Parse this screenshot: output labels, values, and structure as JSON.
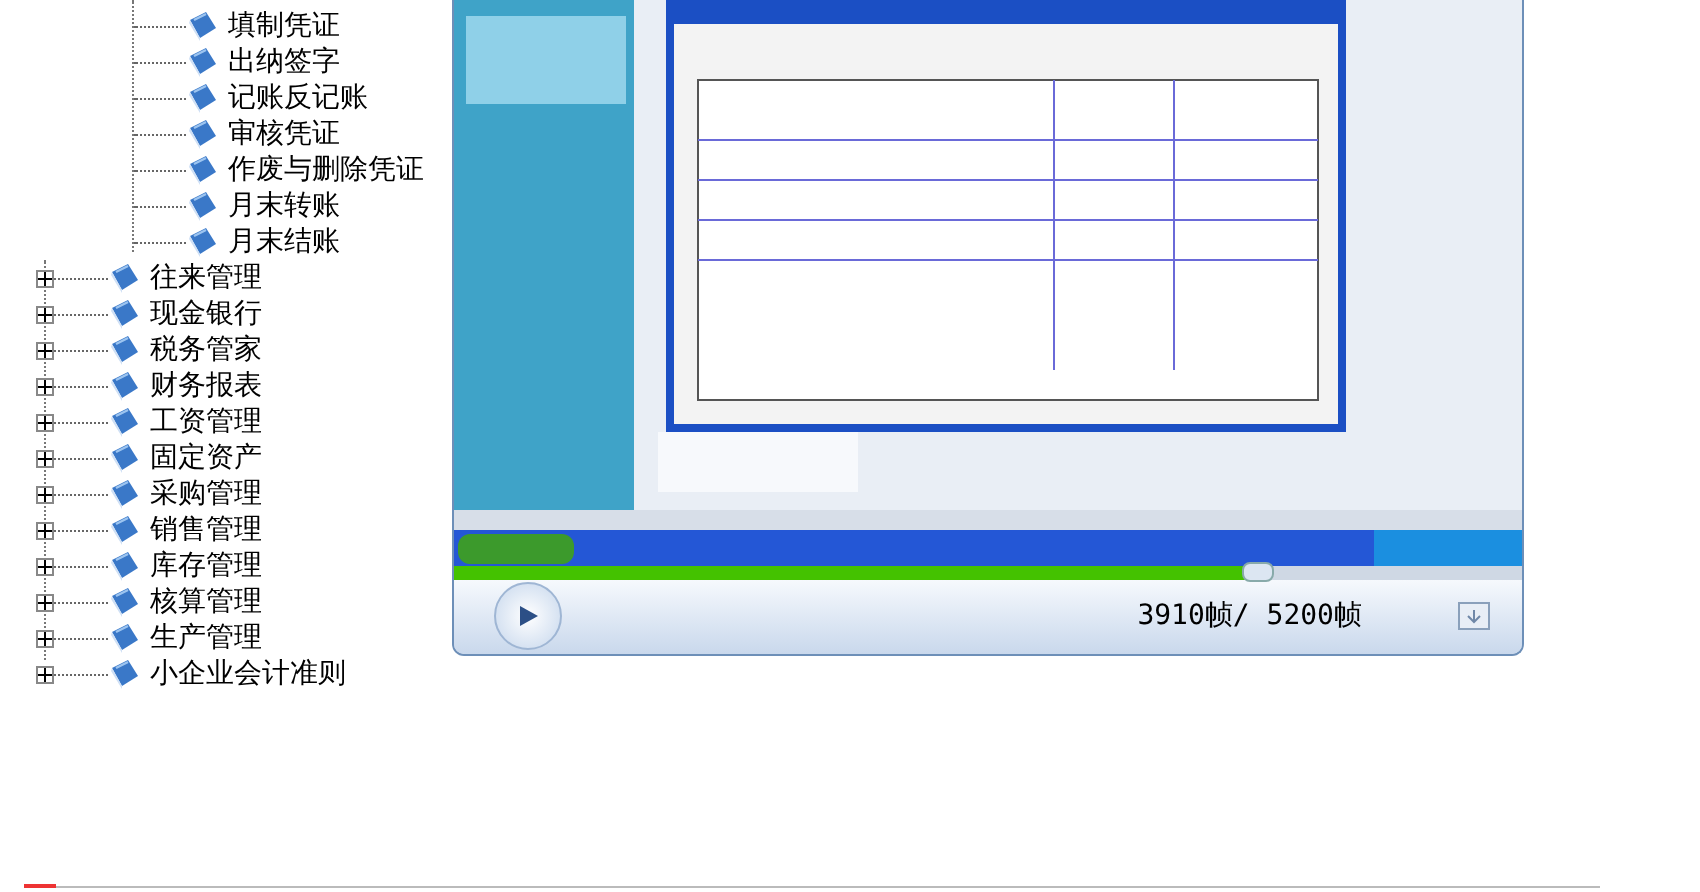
{
  "tree": {
    "children": [
      {
        "label": "填制凭证"
      },
      {
        "label": "出纳签字"
      },
      {
        "label": "记账反记账"
      },
      {
        "label": "审核凭证"
      },
      {
        "label": "作废与删除凭证"
      },
      {
        "label": "月末转账"
      },
      {
        "label": "月末结账"
      }
    ],
    "modules": [
      {
        "label": "往来管理",
        "expanded": false
      },
      {
        "label": "现金银行",
        "expanded": false
      },
      {
        "label": "税务管家",
        "expanded": false
      },
      {
        "label": "财务报表",
        "expanded": false
      },
      {
        "label": "工资管理",
        "expanded": false
      },
      {
        "label": "固定资产",
        "expanded": false
      },
      {
        "label": "采购管理",
        "expanded": false
      },
      {
        "label": "销售管理",
        "expanded": false
      },
      {
        "label": "库存管理",
        "expanded": false
      },
      {
        "label": "核算管理",
        "expanded": false
      },
      {
        "label": "生产管理",
        "expanded": false
      },
      {
        "label": "小企业会计准则",
        "expanded": false
      }
    ]
  },
  "player": {
    "progress": {
      "level": 0.752
    },
    "frame_counter": "3910帧/ 5200帧"
  }
}
